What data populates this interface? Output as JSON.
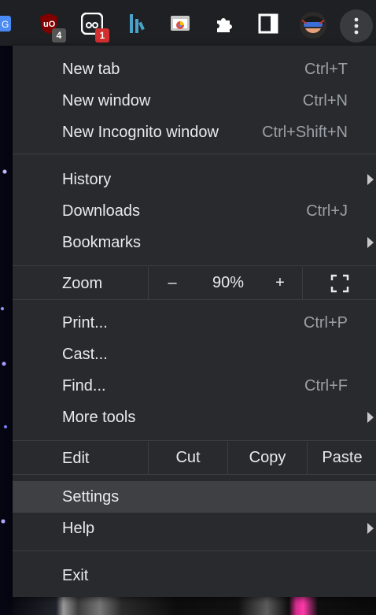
{
  "toolbar": {
    "extensions": [
      {
        "name": "google-translate-icon",
        "badge": ""
      },
      {
        "name": "ublock-origin-icon",
        "badge": "4",
        "badge_color": "#555555"
      },
      {
        "name": "extension-icon",
        "badge": "1",
        "badge_color": "#d32f2f"
      },
      {
        "name": "extension-logo-icon",
        "badge": ""
      },
      {
        "name": "chrome-cast-icon",
        "badge": ""
      },
      {
        "name": "puzzle-icon",
        "badge": ""
      },
      {
        "name": "sidebar-icon",
        "badge": ""
      },
      {
        "name": "profile-avatar",
        "badge": ""
      }
    ],
    "menu_icon": "kebab-menu-icon"
  },
  "menu": {
    "new_tab": {
      "label": "New tab",
      "shortcut": "Ctrl+T"
    },
    "new_window": {
      "label": "New window",
      "shortcut": "Ctrl+N"
    },
    "new_incognito": {
      "label": "New Incognito window",
      "shortcut": "Ctrl+Shift+N"
    },
    "history": {
      "label": "History"
    },
    "downloads": {
      "label": "Downloads",
      "shortcut": "Ctrl+J"
    },
    "bookmarks": {
      "label": "Bookmarks"
    },
    "zoom": {
      "label": "Zoom",
      "minus": "–",
      "value": "90%",
      "plus": "+"
    },
    "print": {
      "label": "Print...",
      "shortcut": "Ctrl+P"
    },
    "cast": {
      "label": "Cast..."
    },
    "find": {
      "label": "Find...",
      "shortcut": "Ctrl+F"
    },
    "more_tools": {
      "label": "More tools"
    },
    "edit": {
      "label": "Edit",
      "cut": "Cut",
      "copy": "Copy",
      "paste": "Paste"
    },
    "settings": {
      "label": "Settings"
    },
    "help": {
      "label": "Help"
    },
    "exit": {
      "label": "Exit"
    }
  },
  "colors": {
    "menu_bg": "#292a2d",
    "hover_bg": "#3f4043",
    "text": "#e8eaed",
    "shortcut": "#9aa0a6"
  }
}
